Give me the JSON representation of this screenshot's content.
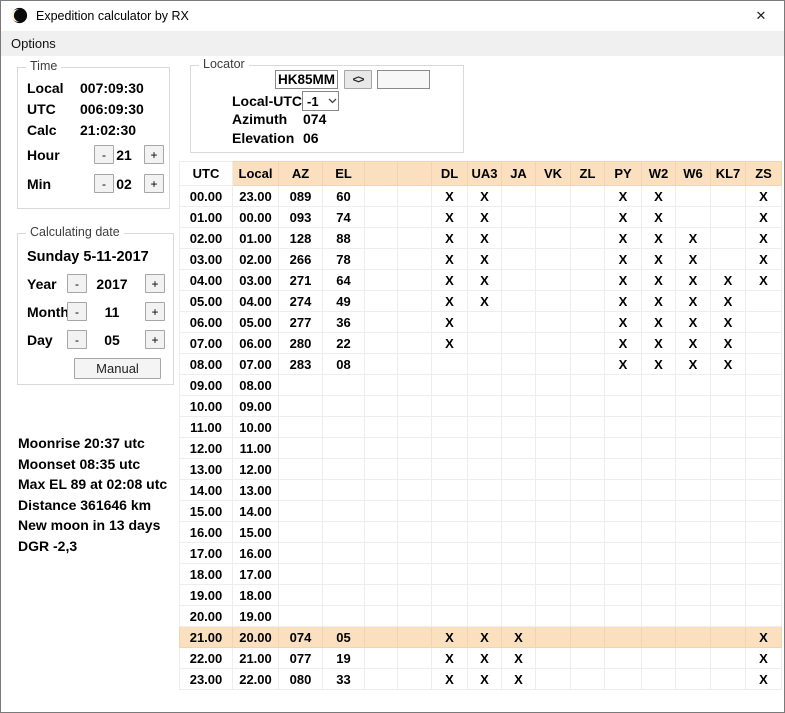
{
  "window": {
    "title": "Expedition calculator by RX",
    "close_glyph": "✕"
  },
  "menu": {
    "options_label": "Options"
  },
  "steppers": {
    "minus": "-",
    "plus": "+"
  },
  "time": {
    "legend": "Time",
    "local_label": "Local",
    "local_value": "007:09:30",
    "utc_label": "UTC",
    "utc_value": "006:09:30",
    "calc_label": "Calc",
    "calc_value": "21:02:30",
    "hour_label": "Hour",
    "hour_value": "21",
    "min_label": "Min",
    "min_value": "02"
  },
  "locator": {
    "legend": "Locator",
    "grid_input_value": "HK85MM",
    "swap_label": "<>",
    "secondary_input_value": "",
    "local_utc_label": "Local-UTC",
    "local_utc_value": "-1",
    "azimuth_label": "Azimuth",
    "azimuth_value": "074",
    "elevation_label": "Elevation",
    "elevation_value": "06"
  },
  "date": {
    "legend": "Calculating date",
    "display": "Sunday 5-11-2017",
    "year_label": "Year",
    "year_value": "2017",
    "month_label": "Month",
    "month_value": "11",
    "day_label": "Day",
    "day_value": "05",
    "manual_label": "Manual"
  },
  "info": {
    "lines": [
      "Moonrise 20:37 utc",
      "Moonset 08:35 utc",
      "Max EL 89 at 02:08 utc",
      "Distance 361646 km",
      "New moon in 13 days",
      "DGR -2,3"
    ]
  },
  "table": {
    "columns": [
      "UTC",
      "Local",
      "AZ",
      "EL",
      "",
      "",
      "DL",
      "UA3",
      "JA",
      "VK",
      "ZL",
      "PY",
      "W2",
      "W6",
      "KL7",
      "ZS"
    ],
    "highlight_row_index": 21,
    "colors": {
      "header_bg": "#FBE0C0",
      "highlight_bg": "#FBE0C0",
      "grid": "#EDEDED"
    },
    "rows": [
      [
        "00.00",
        "23.00",
        "089",
        "60",
        "",
        "",
        "X",
        "X",
        "",
        "",
        "",
        "X",
        "X",
        "",
        "",
        "X"
      ],
      [
        "01.00",
        "00.00",
        "093",
        "74",
        "",
        "",
        "X",
        "X",
        "",
        "",
        "",
        "X",
        "X",
        "",
        "",
        "X"
      ],
      [
        "02.00",
        "01.00",
        "128",
        "88",
        "",
        "",
        "X",
        "X",
        "",
        "",
        "",
        "X",
        "X",
        "X",
        "",
        "X"
      ],
      [
        "03.00",
        "02.00",
        "266",
        "78",
        "",
        "",
        "X",
        "X",
        "",
        "",
        "",
        "X",
        "X",
        "X",
        "",
        "X"
      ],
      [
        "04.00",
        "03.00",
        "271",
        "64",
        "",
        "",
        "X",
        "X",
        "",
        "",
        "",
        "X",
        "X",
        "X",
        "X",
        "X"
      ],
      [
        "05.00",
        "04.00",
        "274",
        "49",
        "",
        "",
        "X",
        "X",
        "",
        "",
        "",
        "X",
        "X",
        "X",
        "X",
        ""
      ],
      [
        "06.00",
        "05.00",
        "277",
        "36",
        "",
        "",
        "X",
        "",
        "",
        "",
        "",
        "X",
        "X",
        "X",
        "X",
        ""
      ],
      [
        "07.00",
        "06.00",
        "280",
        "22",
        "",
        "",
        "X",
        "",
        "",
        "",
        "",
        "X",
        "X",
        "X",
        "X",
        ""
      ],
      [
        "08.00",
        "07.00",
        "283",
        "08",
        "",
        "",
        "",
        "",
        "",
        "",
        "",
        "X",
        "X",
        "X",
        "X",
        ""
      ],
      [
        "09.00",
        "08.00",
        "",
        "",
        "",
        "",
        "",
        "",
        "",
        "",
        "",
        "",
        "",
        "",
        "",
        ""
      ],
      [
        "10.00",
        "09.00",
        "",
        "",
        "",
        "",
        "",
        "",
        "",
        "",
        "",
        "",
        "",
        "",
        "",
        ""
      ],
      [
        "11.00",
        "10.00",
        "",
        "",
        "",
        "",
        "",
        "",
        "",
        "",
        "",
        "",
        "",
        "",
        "",
        ""
      ],
      [
        "12.00",
        "11.00",
        "",
        "",
        "",
        "",
        "",
        "",
        "",
        "",
        "",
        "",
        "",
        "",
        "",
        ""
      ],
      [
        "13.00",
        "12.00",
        "",
        "",
        "",
        "",
        "",
        "",
        "",
        "",
        "",
        "",
        "",
        "",
        "",
        ""
      ],
      [
        "14.00",
        "13.00",
        "",
        "",
        "",
        "",
        "",
        "",
        "",
        "",
        "",
        "",
        "",
        "",
        "",
        ""
      ],
      [
        "15.00",
        "14.00",
        "",
        "",
        "",
        "",
        "",
        "",
        "",
        "",
        "",
        "",
        "",
        "",
        "",
        ""
      ],
      [
        "16.00",
        "15.00",
        "",
        "",
        "",
        "",
        "",
        "",
        "",
        "",
        "",
        "",
        "",
        "",
        "",
        ""
      ],
      [
        "17.00",
        "16.00",
        "",
        "",
        "",
        "",
        "",
        "",
        "",
        "",
        "",
        "",
        "",
        "",
        "",
        ""
      ],
      [
        "18.00",
        "17.00",
        "",
        "",
        "",
        "",
        "",
        "",
        "",
        "",
        "",
        "",
        "",
        "",
        "",
        ""
      ],
      [
        "19.00",
        "18.00",
        "",
        "",
        "",
        "",
        "",
        "",
        "",
        "",
        "",
        "",
        "",
        "",
        "",
        ""
      ],
      [
        "20.00",
        "19.00",
        "",
        "",
        "",
        "",
        "",
        "",
        "",
        "",
        "",
        "",
        "",
        "",
        "",
        ""
      ],
      [
        "21.00",
        "20.00",
        "074",
        "05",
        "",
        "",
        "X",
        "X",
        "X",
        "",
        "",
        "",
        "",
        "",
        "",
        "X"
      ],
      [
        "22.00",
        "21.00",
        "077",
        "19",
        "",
        "",
        "X",
        "X",
        "X",
        "",
        "",
        "",
        "",
        "",
        "",
        "X"
      ],
      [
        "23.00",
        "22.00",
        "080",
        "33",
        "",
        "",
        "X",
        "X",
        "X",
        "",
        "",
        "",
        "",
        "",
        "",
        "X"
      ]
    ]
  }
}
